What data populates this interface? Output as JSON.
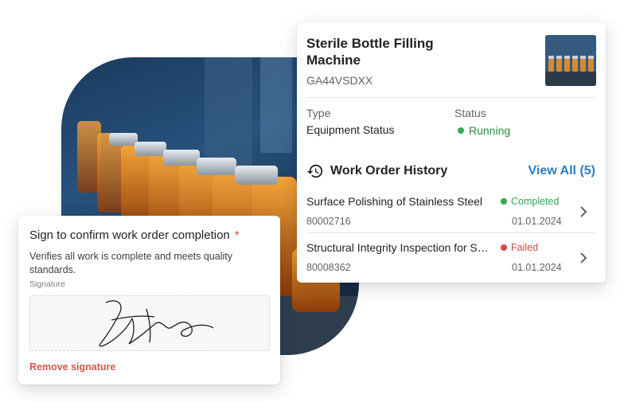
{
  "equipment": {
    "title": "Sterile Bottle Filling Machine",
    "code": "GA44VSDXX",
    "type_label": "Type",
    "type_value": "Equipment Status",
    "status_label": "Status",
    "status_value": "Running",
    "status_color": "#34a853"
  },
  "history": {
    "title": "Work Order History",
    "view_all": "View All (5)",
    "items": [
      {
        "name": "Surface Polishing of Stainless Steel",
        "status": "Completed",
        "status_color": "#34a853",
        "number": "80002716",
        "date": "01.01.2024"
      },
      {
        "name": "Structural Integrity Inspection for Stainless Steel",
        "status": "Failed",
        "status_color": "#d9473f",
        "number": "80008362",
        "date": "01.01.2024"
      }
    ]
  },
  "signature": {
    "title": "Sign to confirm work order completion",
    "required_mark": "*",
    "description": "Verifies all work is complete and meets quality standards.",
    "field_label": "Signature",
    "remove_label": "Remove signature"
  },
  "colors": {
    "accent": "#2d7fc1",
    "danger": "#d0564a"
  }
}
